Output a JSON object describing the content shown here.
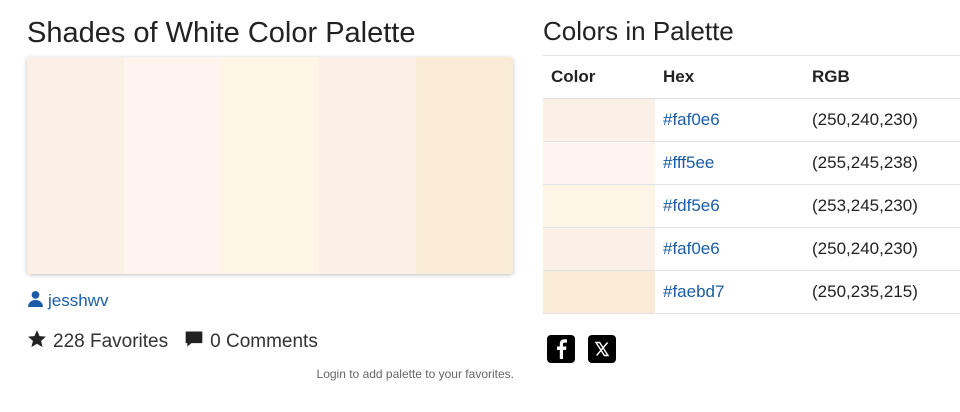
{
  "left": {
    "title": "Shades of White Color Palette",
    "palette_colors": [
      "#faf0e6",
      "#fff5ee",
      "#fdf5e6",
      "#faf0e6",
      "#faebd7"
    ],
    "author": "jesshwv",
    "favorites": "228 Favorites",
    "comments": "0 Comments",
    "login_note": "Login to add palette to your favorites."
  },
  "right": {
    "title": "Colors in Palette",
    "table": {
      "headers": {
        "color": "Color",
        "hex": "Hex",
        "rgb": "RGB"
      },
      "rows": [
        {
          "color": "#faf0e6",
          "hex": "#faf0e6",
          "rgb": "(250,240,230)"
        },
        {
          "color": "#fff5ee",
          "hex": "#fff5ee",
          "rgb": "(255,245,238)"
        },
        {
          "color": "#fdf5e6",
          "hex": "#fdf5e6",
          "rgb": "(253,245,230)"
        },
        {
          "color": "#faf0e6",
          "hex": "#faf0e6",
          "rgb": "(250,240,230)"
        },
        {
          "color": "#faebd7",
          "hex": "#faebd7",
          "rgb": "(250,235,215)"
        }
      ]
    },
    "share_icons": [
      "facebook-icon",
      "x-icon"
    ]
  },
  "colors": {
    "link": "#1a5da6",
    "text": "#212529",
    "border": "#dee2e6"
  }
}
